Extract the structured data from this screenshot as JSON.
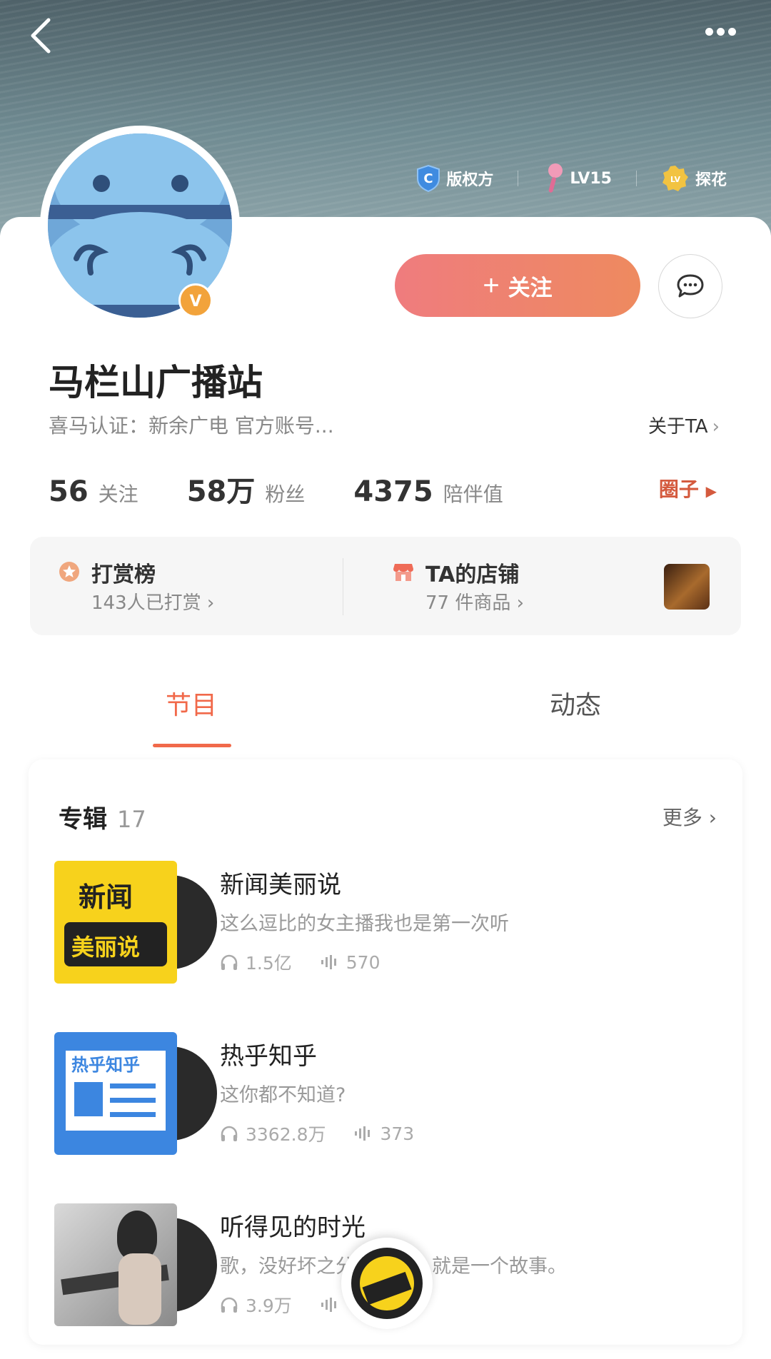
{
  "header": {
    "badges": [
      {
        "icon": "copyright-shield-icon",
        "label": "版权方"
      },
      {
        "icon": "microphone-icon",
        "label": "LV15"
      },
      {
        "icon": "lv-medal-icon",
        "label": "探花"
      }
    ]
  },
  "profile": {
    "name": "马栏山广播站",
    "verification": "喜马认证：新余广电 官方账号...",
    "about_link": "关于TA",
    "follow_label": "关注",
    "stats": [
      {
        "value": "56",
        "label": "关注"
      },
      {
        "value": "58万",
        "label": "粉丝"
      },
      {
        "value": "4375",
        "label": "陪伴值"
      }
    ],
    "circle_link": "圈子"
  },
  "panel": {
    "reward_title": "打赏榜",
    "reward_sub": "143人已打赏",
    "shop_title": "TA的店铺",
    "shop_sub": "77 件商品"
  },
  "tabs": [
    {
      "label": "节目",
      "active": true
    },
    {
      "label": "动态",
      "active": false
    }
  ],
  "albums": {
    "heading": "专辑",
    "count": "17",
    "more": "更多",
    "items": [
      {
        "title": "新闻美丽说",
        "desc": "这么逗比的女主播我也是第一次听",
        "plays": "1.5亿",
        "tracks": "570",
        "cover_line1": "新闻",
        "cover_line2": "美丽说"
      },
      {
        "title": "热乎知乎",
        "desc": "这你都不知道?",
        "plays": "3362.8万",
        "tracks": "373",
        "cover_line1": "热乎知乎"
      },
      {
        "title": "听得见的时光",
        "desc": "歌，没好坏之分，你的，就是一个故事。",
        "plays": "3.9万",
        "tracks": ""
      }
    ]
  },
  "colors": {
    "accent": "#f1694a",
    "follow_start": "#ef7c7e",
    "follow_end": "#ee8a5f",
    "header": "#5a6f76"
  }
}
